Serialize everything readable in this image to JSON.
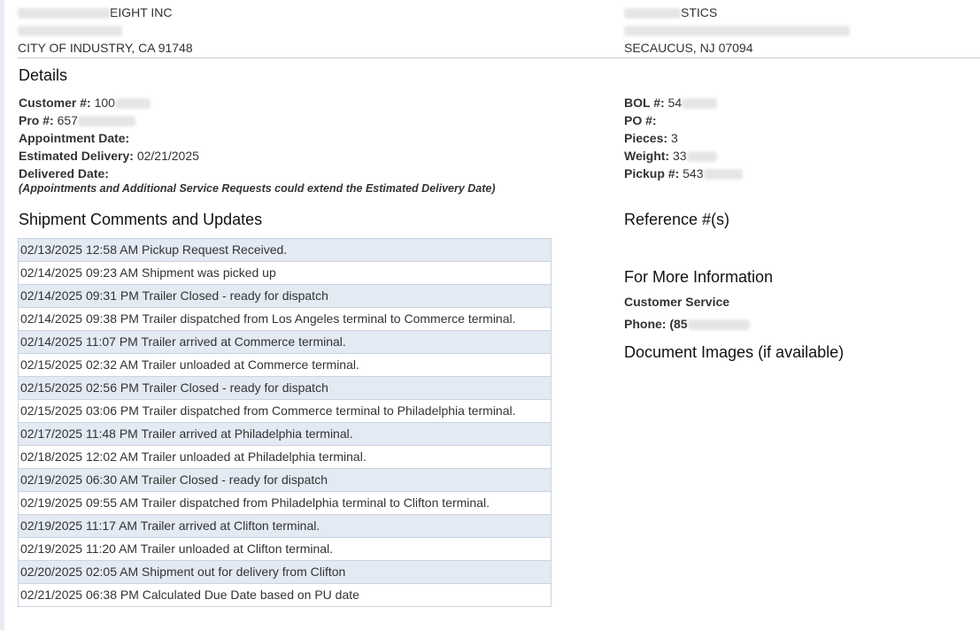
{
  "shipper": {
    "name_suffix": "EIGHT INC",
    "city_line": "CITY OF INDUSTRY, CA 91748"
  },
  "consignee": {
    "name_suffix": "STICS",
    "city_line": "SECAUCUS, NJ 07094"
  },
  "details": {
    "title": "Details",
    "customer_label": "Customer #:",
    "customer_value": "100",
    "pro_label": "Pro #:",
    "pro_value": "657",
    "appointment_label": "Appointment Date:",
    "estimated_label": "Estimated Delivery:",
    "estimated_value": "02/21/2025",
    "delivered_label": "Delivered Date:",
    "note": "(Appointments and Additional Service Requests could extend the Estimated Delivery Date)",
    "bol_label": "BOL #:",
    "bol_value": "54",
    "po_label": "PO #:",
    "pieces_label": "Pieces:",
    "pieces_value": "3",
    "weight_label": "Weight:",
    "weight_value": "33",
    "pickup_label": "Pickup #:",
    "pickup_value": "543"
  },
  "comments": {
    "title": "Shipment Comments and Updates",
    "rows": [
      "02/13/2025 12:58 AM Pickup Request Received.",
      "02/14/2025 09:23 AM Shipment was picked up",
      "02/14/2025 09:31 PM Trailer Closed - ready for dispatch",
      "02/14/2025 09:38 PM Trailer dispatched from Los Angeles terminal to Commerce terminal.",
      "02/14/2025 11:07 PM Trailer arrived at Commerce terminal.",
      "02/15/2025 02:32 AM Trailer unloaded at Commerce terminal.",
      "02/15/2025 02:56 PM Trailer Closed - ready for dispatch",
      "02/15/2025 03:06 PM Trailer dispatched from Commerce terminal to Philadelphia terminal.",
      "02/17/2025 11:48 PM Trailer arrived at Philadelphia terminal.",
      "02/18/2025 12:02 AM Trailer unloaded at Philadelphia terminal.",
      "02/19/2025 06:30 AM Trailer Closed - ready for dispatch",
      "02/19/2025 09:55 AM Trailer dispatched from Philadelphia terminal to Clifton terminal.",
      "02/19/2025 11:17 AM Trailer arrived at Clifton terminal.",
      "02/19/2025 11:20 AM Trailer unloaded at Clifton terminal.",
      "02/20/2025 02:05 AM Shipment out for delivery from Clifton",
      "02/21/2025 06:38 PM Calculated Due Date based on PU date"
    ]
  },
  "reference": {
    "title": "Reference #(s)"
  },
  "more_info": {
    "title": "For More Information",
    "customer_service": "Customer Service",
    "phone_label": "Phone: (85"
  },
  "documents": {
    "title": "Document Images (if available)"
  }
}
